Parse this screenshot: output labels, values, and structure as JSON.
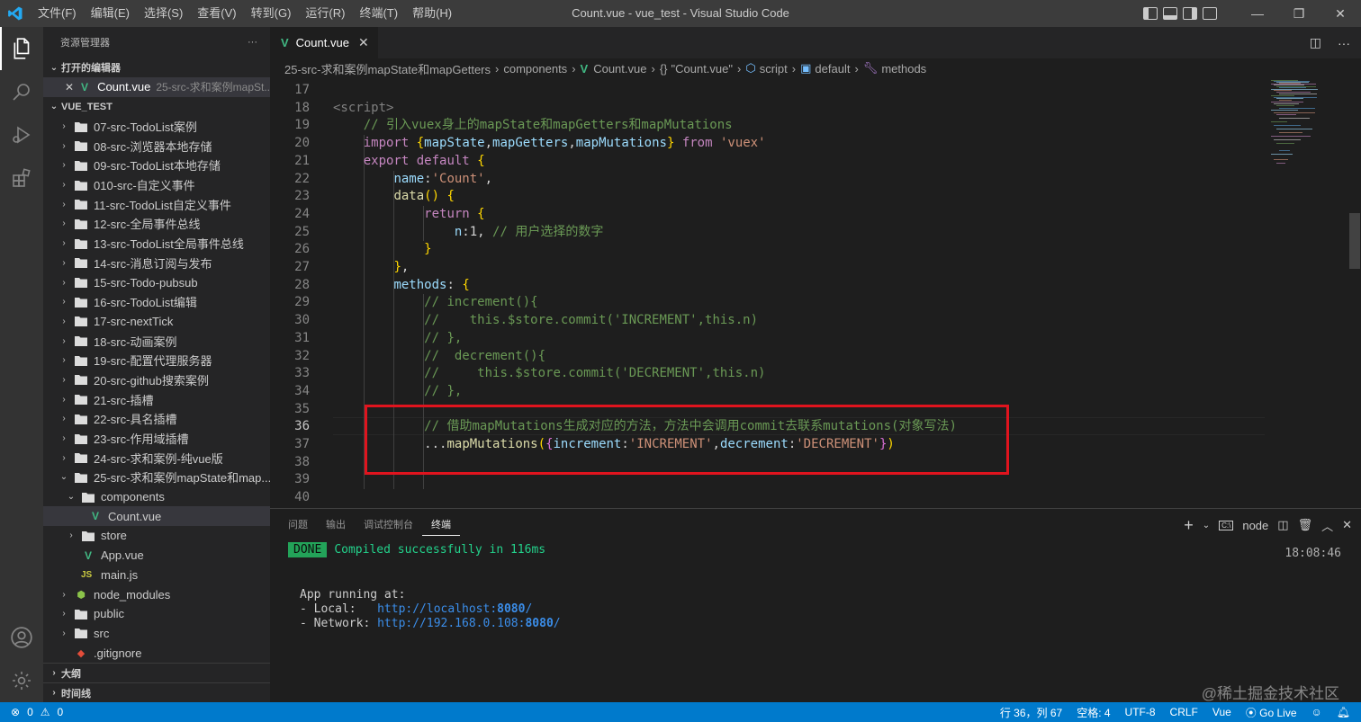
{
  "titlebar": {
    "menu": [
      "文件(F)",
      "编辑(E)",
      "选择(S)",
      "查看(V)",
      "转到(G)",
      "运行(R)",
      "终端(T)",
      "帮助(H)"
    ],
    "title": "Count.vue - vue_test - Visual Studio Code"
  },
  "sidebar": {
    "header": "资源管理器",
    "open_editors_label": "打开的编辑器",
    "open_editor": {
      "name": "Count.vue",
      "path": "25-src-求和案例mapSt..."
    },
    "workspace_label": "VUE_TEST",
    "items": [
      "07-src-TodoList案例",
      "08-src-浏览器本地存储",
      "09-src-TodoList本地存储",
      "010-src-自定义事件",
      "11-src-TodoList自定义事件",
      "12-src-全局事件总线",
      "13-src-TodoList全局事件总线",
      "14-src-消息订阅与发布",
      "15-src-Todo-pubsub",
      "16-src-TodoList编辑",
      "17-src-nextTick",
      "18-src-动画案例",
      "19-src-配置代理服务器",
      "20-src-github搜索案例",
      "21-src-插槽",
      "22-src-具名插槽",
      "23-src-作用域插槽",
      "24-src-求和案例-纯vue版",
      "25-src-求和案例mapState和map...",
      "components",
      "Count.vue",
      "store",
      "App.vue",
      "main.js",
      "node_modules",
      "public",
      "src",
      ".gitignore"
    ],
    "outline_label": "大纲",
    "timeline_label": "时间线"
  },
  "tab": {
    "label": "Count.vue",
    "close": "✕"
  },
  "breadcrumb": {
    "folder": "25-src-求和案例mapState和mapGetters",
    "sub": "components",
    "file": "Count.vue",
    "scope": "\"Count.vue\"",
    "script": "script",
    "default": "default",
    "methods": "methods"
  },
  "code": {
    "line_numbers": [
      "17",
      "18",
      "19",
      "20",
      "21",
      "22",
      "23",
      "24",
      "25",
      "26",
      "27",
      "28",
      "29",
      "30",
      "31",
      "32",
      "33",
      "34",
      "35",
      "36",
      "37",
      "38",
      "39",
      "40"
    ],
    "lines": [
      "",
      "<script>",
      "    // 引入vuex身上的mapState和mapGetters和mapMutations",
      "    import {mapState,mapGetters,mapMutations} from 'vuex'",
      "    export default {",
      "        name:'Count',",
      "        data() {",
      "            return {",
      "                n:1, // 用户选择的数字",
      "            }",
      "        },",
      "        methods: {",
      "            // increment(){",
      "            //    this.$store.commit('INCREMENT',this.n)",
      "            // },",
      "            //  decrement(){",
      "            //     this.$store.commit('DECREMENT',this.n)",
      "            // },",
      "",
      "            // 借助mapMutations生成对应的方法，方法中会调用commit去联系mutations(对象写法)",
      "            ...mapMutations({increment:'INCREMENT',decrement:'DECREMENT'})",
      "",
      "",
      ""
    ]
  },
  "panel": {
    "tabs": [
      "问题",
      "输出",
      "调试控制台",
      "终端"
    ],
    "terminal_name": "node",
    "done_badge": "DONE",
    "compiled": "Compiled successfully in 116ms",
    "time": "18:08:46",
    "app_running": "App running at:",
    "local_label": "- Local:   ",
    "local_url": "http://localhost:",
    "local_port": "8080",
    "local_tail": "/",
    "network_label": "- Network: ",
    "network_url": "http://192.168.0.108:",
    "network_port": "8080",
    "network_tail": "/"
  },
  "status": {
    "errors": "0",
    "warnings": "0",
    "position": "行 36，列 67",
    "spaces": "空格: 4",
    "encoding": "UTF-8",
    "eol": "CRLF",
    "language": "Vue",
    "golive": "Go Live"
  },
  "watermark": "@稀土掘金技术社区",
  "colors": {
    "accent": "#007acc",
    "highlight_box": "#e0141e",
    "vue_green": "#41b883"
  }
}
